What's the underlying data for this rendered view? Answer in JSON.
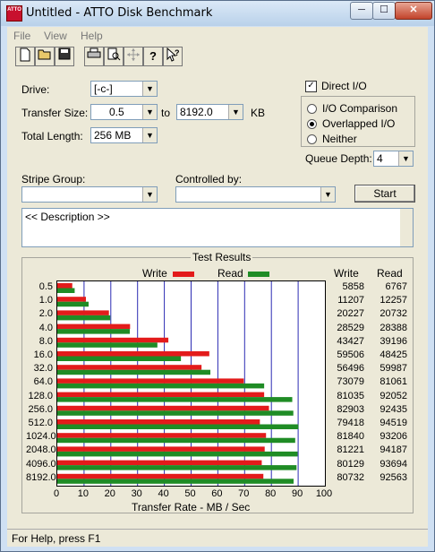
{
  "window": {
    "title": "Untitled - ATTO Disk Benchmark",
    "app_icon_text": "ATTO",
    "min": "─",
    "max": "☐",
    "close": "✕"
  },
  "menu": [
    "File",
    "View",
    "Help"
  ],
  "toolbar": {
    "icons": [
      "new-document-icon",
      "open-folder-icon",
      "save-icon",
      "print-icon",
      "print-preview-icon",
      "move-icon",
      "help-icon",
      "context-help-icon"
    ]
  },
  "form": {
    "drive_label": "Drive:",
    "drive_value": "[-c-]",
    "transfer_size_label": "Transfer Size:",
    "transfer_from": "0.5",
    "to_label": "to",
    "transfer_to": "8192.0",
    "kb_label": "KB",
    "total_length_label": "Total Length:",
    "total_length_value": "256 MB",
    "direct_io_label": "Direct I/O",
    "direct_io_checked": true,
    "io_comparison_label": "I/O Comparison",
    "overlapped_io_label": "Overlapped I/O",
    "neither_label": "Neither",
    "selected_mode": "Overlapped I/O",
    "queue_depth_label": "Queue Depth:",
    "queue_depth_value": "4",
    "stripe_group_label": "Stripe Group:",
    "stripe_group_value": "",
    "controlled_by_label": "Controlled by:",
    "controlled_by_value": "",
    "start_label": "Start",
    "description_text": "<< Description >>"
  },
  "results": {
    "title": "Test Results",
    "write_label": "Write",
    "read_label": "Read",
    "col_write": "Write",
    "col_read": "Read",
    "write_color": "#e31b1b",
    "read_color": "#1f8c25",
    "grid_color": "#2b2bb3",
    "xlabel": "Transfer Rate - MB / Sec"
  },
  "chart_data": {
    "type": "bar",
    "orientation": "horizontal",
    "title": "Test Results",
    "xlabel": "Transfer Rate - MB / Sec",
    "xlim": [
      0,
      100
    ],
    "xticks": [
      "0",
      "10",
      "20",
      "30",
      "40",
      "50",
      "60",
      "70",
      "80",
      "90",
      "100"
    ],
    "categories": [
      "0.5",
      "1.0",
      "2.0",
      "4.0",
      "8.0",
      "16.0",
      "32.0",
      "64.0",
      "128.0",
      "256.0",
      "512.0",
      "1024.0",
      "2048.0",
      "4096.0",
      "8192.0"
    ],
    "series": [
      {
        "name": "Write",
        "values": [
          5.6,
          10.7,
          19.3,
          27.2,
          41.5,
          56.8,
          53.9,
          69.7,
          77.3,
          79.1,
          75.7,
          78.0,
          77.5,
          76.4,
          77.0
        ]
      },
      {
        "name": "Read",
        "values": [
          6.5,
          11.7,
          19.8,
          27.1,
          37.4,
          46.2,
          57.2,
          77.3,
          87.8,
          88.2,
          90.1,
          88.9,
          89.8,
          89.4,
          88.3
        ]
      }
    ],
    "write_numbers": [
      "5858",
      "11207",
      "20227",
      "28529",
      "43427",
      "59506",
      "56496",
      "73079",
      "81035",
      "82903",
      "79418",
      "81840",
      "81221",
      "80129",
      "80732"
    ],
    "read_numbers": [
      "6767",
      "12257",
      "20732",
      "28388",
      "39196",
      "48425",
      "59987",
      "81061",
      "92052",
      "92435",
      "94519",
      "93206",
      "94187",
      "93694",
      "92563"
    ],
    "grid": true,
    "legend": "top"
  },
  "status": {
    "text": "For Help, press F1"
  }
}
